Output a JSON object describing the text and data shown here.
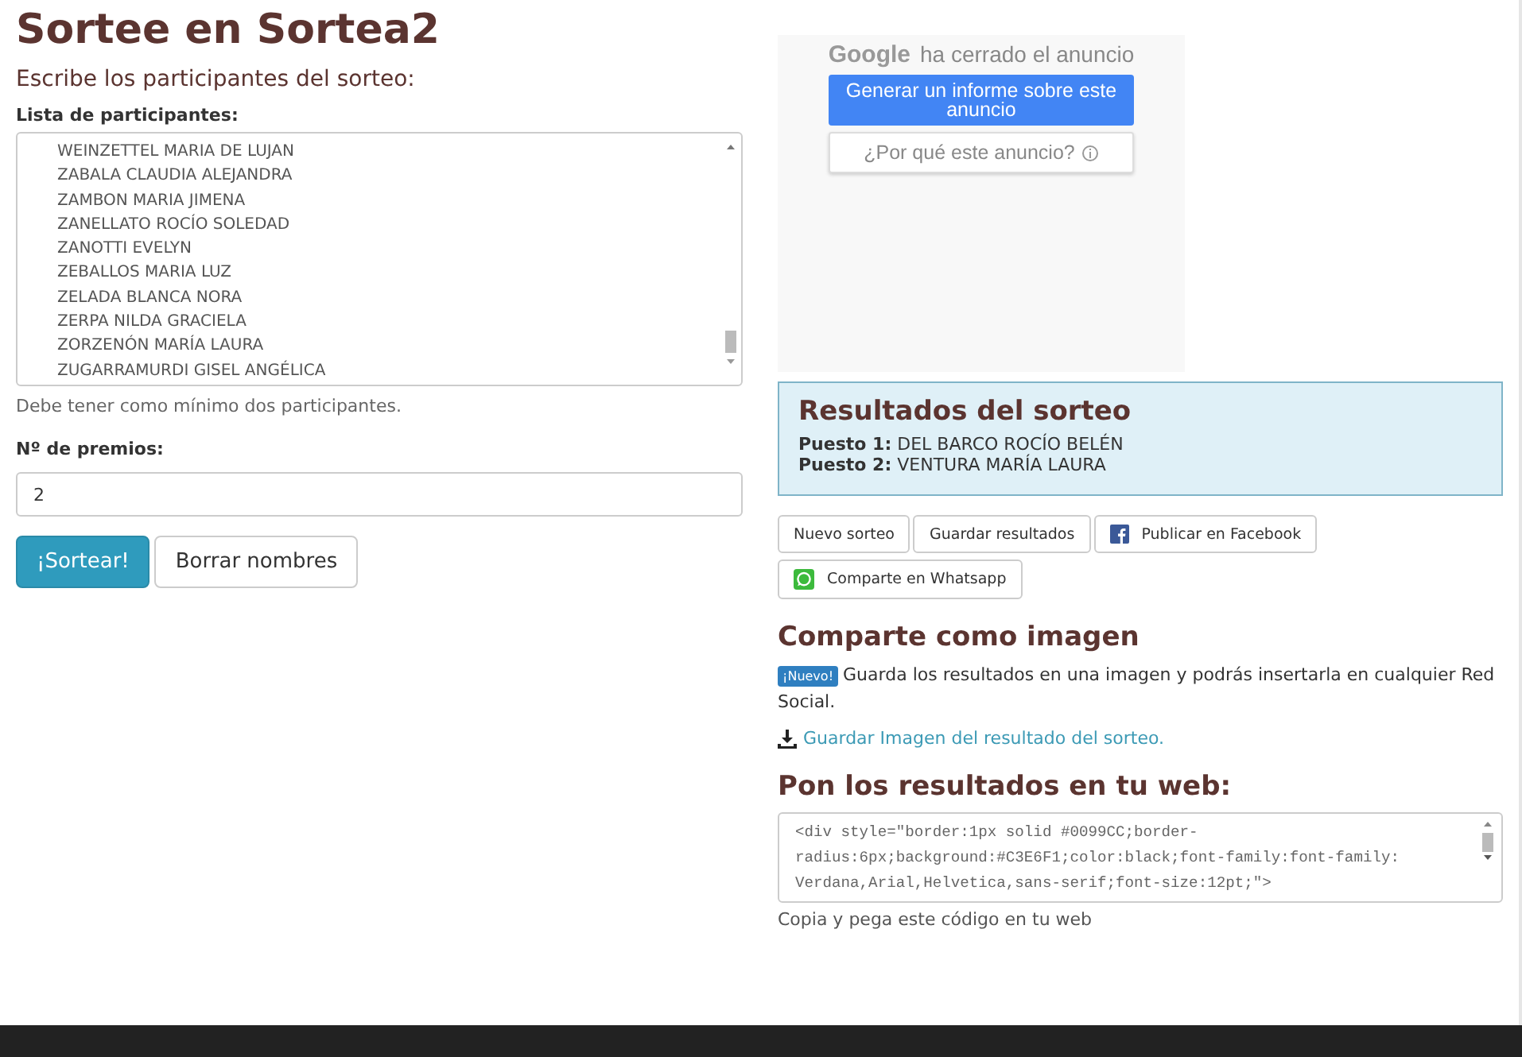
{
  "title": "Sortee en Sortea2",
  "form": {
    "heading": "Escribe los participantes del sorteo:",
    "list_label": "Lista de participantes:",
    "participants": [
      "WEINZETTEL MARIA DE LUJAN",
      "ZABALA CLAUDIA ALEJANDRA",
      "ZAMBON MARIA JIMENA",
      "ZANELLATO ROCÍO SOLEDAD",
      "ZANOTTI EVELYN",
      "ZEBALLOS MARIA LUZ",
      "ZELADA BLANCA NORA",
      "ZERPA NILDA GRACIELA",
      "ZORZENÓN MARÍA LAURA",
      "ZUGARRAMURDI GISEL ANGÉLICA"
    ],
    "hint": "Debe tener como mínimo dos participantes.",
    "prizes_label": "Nº de premios:",
    "prizes_value": "2",
    "buttons": [
      {
        "label": "¡Sortear!",
        "kind": "primary"
      },
      {
        "label": "Borrar nombres",
        "kind": "default"
      }
    ]
  },
  "ad": {
    "brand": "Google",
    "closed_text": "ha cerrado el anuncio",
    "report_button": "Generar un informe sobre este anuncio",
    "why_button": "¿Por qué este anuncio?"
  },
  "results": {
    "title": "Resultados del sorteo",
    "places": [
      {
        "label": "Puesto 1:",
        "name": "DEL BARCO ROCÍO BELÉN"
      },
      {
        "label": "Puesto 2:",
        "name": "VENTURA MARÍA LAURA"
      }
    ]
  },
  "actions": [
    {
      "label": "Nuevo sorteo",
      "kind": "plain"
    },
    {
      "label": "Guardar resultados",
      "kind": "plain"
    },
    {
      "label": "Publicar en Facebook",
      "kind": "facebook"
    },
    {
      "label": "Comparte en Whatsapp",
      "kind": "whatsapp"
    }
  ],
  "share_image": {
    "title": "Comparte como imagen",
    "badge": "¡Nuevo!",
    "text": "Guarda los resultados en una imagen y podrás insertarla en cualquier Red Social.",
    "link": "Guardar Imagen del resultado del sorteo."
  },
  "embed": {
    "title": "Pon los resultados en tu web:",
    "code": "<div style=\"border:1px solid #0099CC;border-radius:6px;background:#C3E6F1;color:black;font-family:font-family: Verdana,Arial,Helvetica,sans-serif;font-size:12pt;\">",
    "hint": "Copia y pega este código en tu web"
  }
}
